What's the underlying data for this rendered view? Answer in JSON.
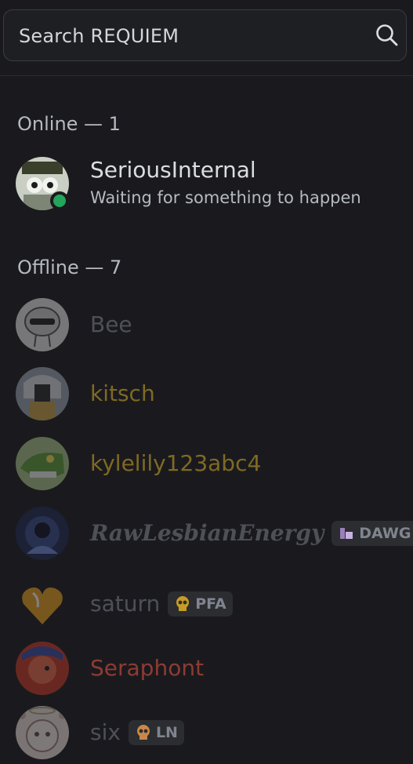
{
  "search": {
    "placeholder": "Search REQUIEM",
    "icon": "search-icon"
  },
  "colors": {
    "background": "#1a1a1e",
    "online_status": "#23a55a",
    "gold_role": "#7e6a22",
    "red_role": "#8e3b32",
    "muted": "#4e5058"
  },
  "sections": {
    "online": {
      "label": "Online — 1"
    },
    "offline": {
      "label": "Offline — 7"
    }
  },
  "members": {
    "seriousinternal": {
      "name": "SeriousInternal",
      "activity": "Waiting for something to happen",
      "status": "online"
    },
    "bee": {
      "name": "Bee",
      "status": "offline"
    },
    "kitsch": {
      "name": "kitsch",
      "status": "offline"
    },
    "kylelily": {
      "name": "kylelily123abc4",
      "status": "offline"
    },
    "rawlesbian": {
      "name": "RawLesbianEnergy",
      "tag": "DAWG",
      "status": "offline"
    },
    "saturn": {
      "name": "saturn",
      "tag": "PFA",
      "status": "offline"
    },
    "seraphont": {
      "name": "Seraphont",
      "status": "offline"
    },
    "six": {
      "name": "six",
      "tag": "LN",
      "status": "offline"
    }
  }
}
